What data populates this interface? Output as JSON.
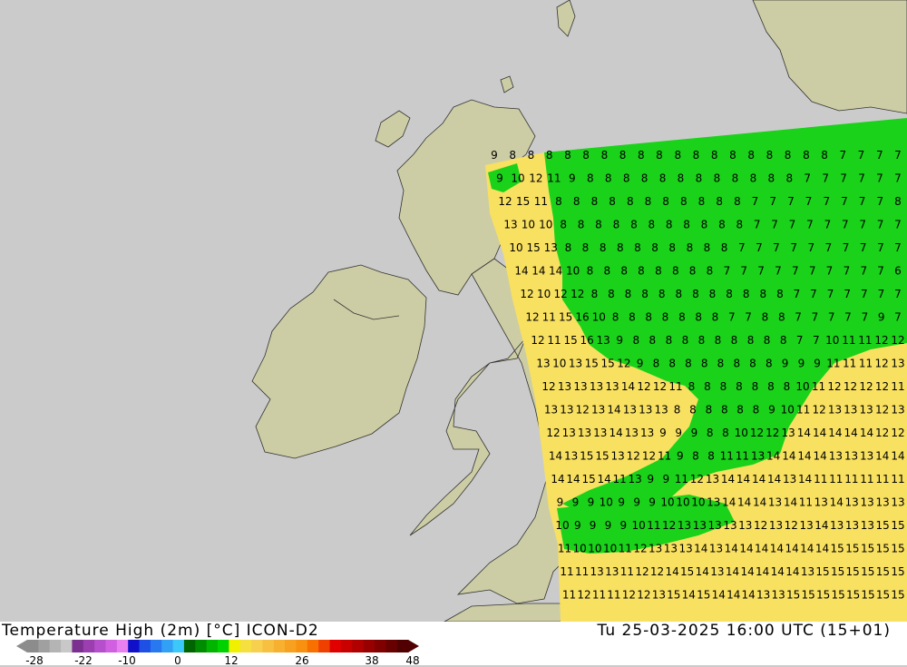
{
  "title": "Temperature High (2m) [°C] ICON-D2",
  "timestamp": "Tu 25-03-2025 16:00 UTC (15+01)",
  "scale": {
    "labels": [
      "-28",
      "-22",
      "-10",
      "0",
      "12",
      "26",
      "38",
      "48"
    ],
    "colors": [
      "#8c8c8c",
      "#a0a0a0",
      "#b4b4b4",
      "#c8c8c8",
      "#7b2f8f",
      "#9b3fb0",
      "#b54fcc",
      "#d060e0",
      "#e880f0",
      "#1010c8",
      "#1e50e6",
      "#2878f0",
      "#32a0f5",
      "#3cc8f8",
      "#006400",
      "#008c00",
      "#00b400",
      "#00d200",
      "#f0f000",
      "#f5e040",
      "#f8d050",
      "#f8c040",
      "#f8b030",
      "#f8a020",
      "#f89010",
      "#f87000",
      "#f04000",
      "#e00000",
      "#c80000",
      "#b00000",
      "#980000",
      "#800000",
      "#680000",
      "#500000"
    ]
  },
  "colors": {
    "sea": "#cbcbcb",
    "land": "#cdcda5",
    "border": "#333333",
    "warm": "#f8e060",
    "warm_alt": "#f8d040",
    "cool": "#19d219",
    "cool_dark": "#10c810"
  },
  "grid_values": [
    [
      "9",
      "8",
      "8",
      "8",
      "8",
      "8",
      "8",
      "8",
      "8",
      "8",
      "8",
      "8",
      "8",
      "8",
      "8",
      "8",
      "8",
      "8",
      "8",
      "7",
      "7",
      "7",
      "7"
    ],
    [
      "9",
      "10",
      "12",
      "11",
      "9",
      "8",
      "8",
      "8",
      "8",
      "8",
      "8",
      "8",
      "8",
      "8",
      "8",
      "8",
      "8",
      "7",
      "7",
      "7",
      "7",
      "7",
      "7"
    ],
    [
      "12",
      "15",
      "11",
      "8",
      "8",
      "8",
      "8",
      "8",
      "8",
      "8",
      "8",
      "8",
      "8",
      "8",
      "7",
      "7",
      "7",
      "7",
      "7",
      "7",
      "7",
      "7",
      "8"
    ],
    [
      "13",
      "10",
      "10",
      "8",
      "8",
      "8",
      "8",
      "8",
      "8",
      "8",
      "8",
      "8",
      "8",
      "8",
      "7",
      "7",
      "7",
      "7",
      "7",
      "7",
      "7",
      "7",
      "7"
    ],
    [
      "10",
      "15",
      "13",
      "8",
      "8",
      "8",
      "8",
      "8",
      "8",
      "8",
      "8",
      "8",
      "8",
      "7",
      "7",
      "7",
      "7",
      "7",
      "7",
      "7",
      "7",
      "7",
      "7"
    ],
    [
      "14",
      "14",
      "14",
      "10",
      "8",
      "8",
      "8",
      "8",
      "8",
      "8",
      "8",
      "8",
      "7",
      "7",
      "7",
      "7",
      "7",
      "7",
      "7",
      "7",
      "7",
      "7",
      "6"
    ],
    [
      "12",
      "10",
      "12",
      "12",
      "8",
      "8",
      "8",
      "8",
      "8",
      "8",
      "8",
      "8",
      "8",
      "8",
      "8",
      "8",
      "7",
      "7",
      "7",
      "7",
      "7",
      "7",
      "7"
    ],
    [
      "12",
      "11",
      "15",
      "16",
      "10",
      "8",
      "8",
      "8",
      "8",
      "8",
      "8",
      "8",
      "7",
      "7",
      "8",
      "8",
      "7",
      "7",
      "7",
      "7",
      "7",
      "9",
      "7"
    ],
    [
      "12",
      "11",
      "15",
      "16",
      "13",
      "9",
      "8",
      "8",
      "8",
      "8",
      "8",
      "8",
      "8",
      "8",
      "8",
      "8",
      "7",
      "7",
      "10",
      "11",
      "11",
      "12",
      "12"
    ],
    [
      "13",
      "10",
      "13",
      "15",
      "15",
      "12",
      "9",
      "8",
      "8",
      "8",
      "8",
      "8",
      "8",
      "8",
      "8",
      "9",
      "9",
      "9",
      "11",
      "11",
      "11",
      "12",
      "13"
    ],
    [
      "12",
      "13",
      "13",
      "13",
      "13",
      "14",
      "12",
      "12",
      "11",
      "8",
      "8",
      "8",
      "8",
      "8",
      "8",
      "8",
      "10",
      "11",
      "12",
      "12",
      "12",
      "12",
      "11"
    ],
    [
      "13",
      "13",
      "12",
      "13",
      "14",
      "13",
      "13",
      "13",
      "8",
      "8",
      "8",
      "8",
      "8",
      "8",
      "9",
      "10",
      "11",
      "12",
      "13",
      "13",
      "13",
      "12",
      "13"
    ],
    [
      "12",
      "13",
      "13",
      "13",
      "14",
      "13",
      "13",
      "9",
      "9",
      "9",
      "8",
      "8",
      "10",
      "12",
      "12",
      "13",
      "14",
      "14",
      "14",
      "14",
      "14",
      "12",
      "12"
    ],
    [
      "14",
      "13",
      "15",
      "15",
      "13",
      "12",
      "12",
      "11",
      "9",
      "8",
      "8",
      "11",
      "11",
      "13",
      "14",
      "14",
      "14",
      "14",
      "13",
      "13",
      "13",
      "14",
      "14"
    ],
    [
      "14",
      "14",
      "15",
      "14",
      "11",
      "13",
      "9",
      "9",
      "11",
      "12",
      "13",
      "14",
      "14",
      "14",
      "14",
      "13",
      "14",
      "11",
      "11",
      "11",
      "11",
      "11",
      "11"
    ],
    [
      "9",
      "9",
      "9",
      "10",
      "9",
      "9",
      "9",
      "10",
      "10",
      "10",
      "13",
      "14",
      "14",
      "14",
      "13",
      "14",
      "11",
      "13",
      "14",
      "13",
      "13",
      "13",
      "13"
    ],
    [
      "10",
      "9",
      "9",
      "9",
      "9",
      "10",
      "11",
      "12",
      "13",
      "13",
      "13",
      "13",
      "13",
      "12",
      "13",
      "12",
      "13",
      "14",
      "13",
      "13",
      "13",
      "15",
      "15"
    ],
    [
      "11",
      "10",
      "10",
      "10",
      "11",
      "12",
      "13",
      "13",
      "13",
      "14",
      "13",
      "14",
      "14",
      "14",
      "14",
      "14",
      "14",
      "14",
      "15",
      "15",
      "15",
      "15",
      "15"
    ],
    [
      "11",
      "11",
      "13",
      "13",
      "11",
      "12",
      "12",
      "14",
      "15",
      "14",
      "13",
      "14",
      "14",
      "14",
      "14",
      "14",
      "13",
      "15",
      "15",
      "15",
      "15",
      "15",
      "15"
    ],
    [
      "11",
      "12",
      "11",
      "11",
      "12",
      "12",
      "13",
      "15",
      "14",
      "15",
      "14",
      "14",
      "14",
      "13",
      "13",
      "15",
      "15",
      "15",
      "15",
      "15",
      "15",
      "15",
      "15"
    ]
  ]
}
